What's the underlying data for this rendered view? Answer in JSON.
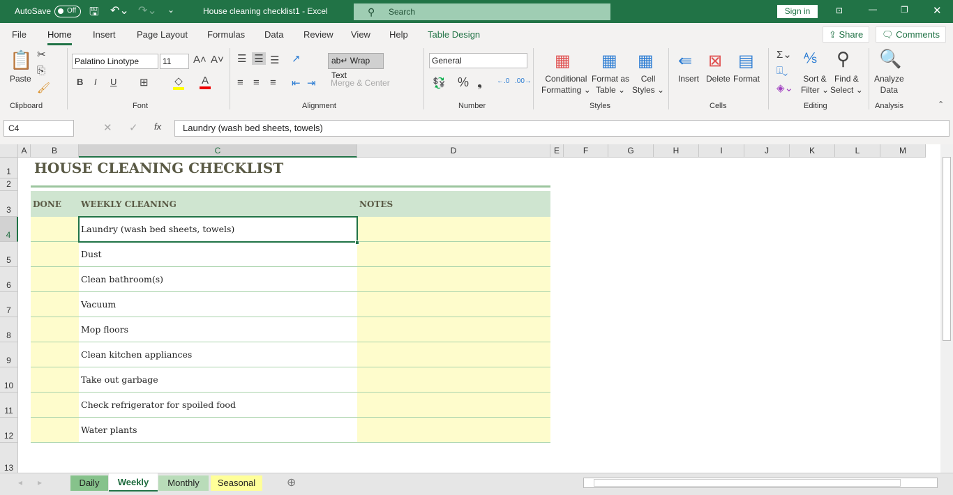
{
  "titlebar": {
    "autosave": "AutoSave",
    "toggle": "Off",
    "doc_title": "House cleaning checklist1  -  Excel",
    "search": "Search",
    "signin": "Sign in"
  },
  "menu": {
    "tabs": [
      "File",
      "Home",
      "Insert",
      "Page Layout",
      "Formulas",
      "Data",
      "Review",
      "View",
      "Help",
      "Table Design"
    ],
    "share": "Share",
    "comments": "Comments"
  },
  "ribbon": {
    "clipboard": {
      "paste": "Paste",
      "group": "Clipboard"
    },
    "font": {
      "name": "Palatino Linotype",
      "size": "11",
      "group": "Font",
      "bold": "B",
      "italic": "I",
      "underline": "U",
      "fill_color": "#ffff00",
      "font_color": "#ff0000"
    },
    "alignment": {
      "wrap": "Wrap Text",
      "merge": "Merge & Center",
      "group": "Alignment"
    },
    "number": {
      "format": "General",
      "group": "Number"
    },
    "styles": {
      "conditional": [
        "Conditional",
        "Formatting"
      ],
      "format_table": [
        "Format as",
        "Table"
      ],
      "cell_styles": [
        "Cell",
        "Styles"
      ],
      "group": "Styles"
    },
    "cells": {
      "insert": "Insert",
      "delete": "Delete",
      "format": "Format",
      "group": "Cells"
    },
    "editing": {
      "sort": [
        "Sort &",
        "Filter"
      ],
      "find": [
        "Find &",
        "Select"
      ],
      "group": "Editing"
    },
    "analysis": {
      "analyze": [
        "Analyze",
        "Data"
      ],
      "group": "Analysis"
    }
  },
  "formula_bar": {
    "name_box": "C4",
    "fx": "fx",
    "content": "Laundry (wash bed sheets, towels)"
  },
  "columns": [
    "A",
    "B",
    "C",
    "D",
    "E",
    "F",
    "G",
    "H",
    "I",
    "J",
    "K",
    "L",
    "M"
  ],
  "selected_cell": "C4",
  "sheet": {
    "title": "HOUSE CLEANING CHECKLIST",
    "headers": {
      "done": "DONE",
      "task": "WEEKLY CLEANING",
      "notes": "NOTES"
    },
    "tasks": [
      "Laundry (wash bed sheets, towels)",
      "Dust",
      "Clean bathroom(s)",
      "Vacuum",
      "Mop floors",
      "Clean kitchen appliances",
      "Take out garbage",
      "Check refrigerator for spoiled food",
      "Water plants"
    ],
    "colors": {
      "header_band": "#cfe5d0",
      "done_fill": "#fefccc",
      "notes_fill": "#fefccc",
      "title": "#5a5a45",
      "accent": "#217346"
    }
  },
  "sheet_tabs": [
    {
      "label": "Daily",
      "color": "#86c28b"
    },
    {
      "label": "Weekly",
      "color": "#ffffff",
      "active": true
    },
    {
      "label": "Monthly",
      "color": "#b9dcb9"
    },
    {
      "label": "Seasonal",
      "color": "#ffff99"
    }
  ]
}
